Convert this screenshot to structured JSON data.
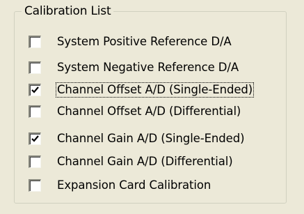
{
  "group": {
    "title": "Calibration List"
  },
  "items": [
    {
      "label": "System Positive Reference D/A",
      "checked": false,
      "focused": false
    },
    {
      "label": "System Negative Reference D/A",
      "checked": false,
      "focused": false
    },
    {
      "label": "Channel Offset A/D (Single-Ended)",
      "checked": true,
      "focused": true
    },
    {
      "label": "Channel Offset A/D (Differential)",
      "checked": false,
      "focused": false
    },
    {
      "label": "Channel Gain A/D (Single-Ended)",
      "checked": true,
      "focused": false
    },
    {
      "label": "Channel Gain A/D (Differential)",
      "checked": false,
      "focused": false
    },
    {
      "label": "Expansion Card Calibration",
      "checked": false,
      "focused": false
    }
  ],
  "icons": {
    "checkmark": "check-icon"
  }
}
